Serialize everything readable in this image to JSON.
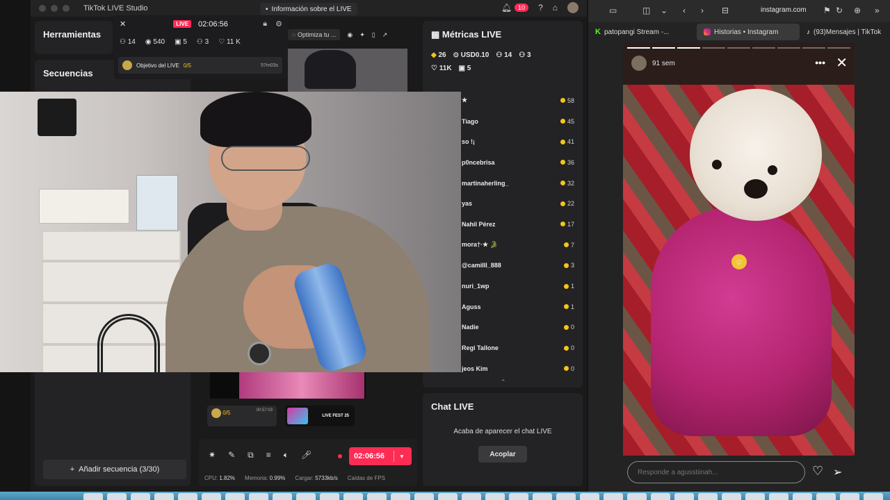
{
  "studio": {
    "title": "TikTok LIVE Studio",
    "info_button": "Información sobre el LIVE",
    "notifications_count": "10",
    "tools_heading": "Herramientas",
    "sequences_heading": "Secuencias",
    "add_sequence": "Añadir secuencia (3/30)",
    "optimize_label": "Optimiza tu ...",
    "live_overlay": {
      "live_tag": "LIVE",
      "timer": "02:06:56",
      "stats": [
        {
          "icon": "people-icon",
          "value": "14"
        },
        {
          "icon": "eye-icon",
          "value": "540"
        },
        {
          "icon": "gift-icon",
          "value": "5"
        },
        {
          "icon": "follow-icon",
          "value": "3"
        },
        {
          "icon": "heart-icon",
          "value": "11 K"
        }
      ],
      "goal_label": "Objetivo del LIVE",
      "goal_progress": "0/5",
      "goal_time": "57m03s"
    },
    "metrics": {
      "heading": "Métricas LIVE",
      "row1": [
        {
          "icon": "diamond-icon",
          "value": "26"
        },
        {
          "icon": "coin-icon",
          "value": "USD0.10"
        },
        {
          "icon": "people-icon",
          "value": "14"
        },
        {
          "icon": "follow-icon",
          "value": "3"
        }
      ],
      "row2": [
        {
          "icon": "heart-icon",
          "value": "11K"
        },
        {
          "icon": "gift-icon",
          "value": "5"
        }
      ],
      "gifters": [
        {
          "name": "★",
          "coins": "58"
        },
        {
          "name": "Tiago",
          "coins": "45"
        },
        {
          "name": "so !¡",
          "coins": "41"
        },
        {
          "name": "p0ncebrisa",
          "coins": "36"
        },
        {
          "name": "martinaherling_",
          "coins": "32"
        },
        {
          "name": "yas",
          "coins": "22"
        },
        {
          "name": "Nahil Pérez",
          "coins": "17"
        },
        {
          "name": "mora†·★ 🐊",
          "coins": "7"
        },
        {
          "name": "@camilll_888",
          "coins": "3"
        },
        {
          "name": "nuri_1wp",
          "coins": "1"
        },
        {
          "name": "Aguss",
          "coins": "1"
        },
        {
          "name": "Nadie",
          "coins": "0"
        },
        {
          "name": "Regi Tallone",
          "coins": "0"
        },
        {
          "name": "jeos Kim",
          "coins": "0"
        }
      ]
    },
    "chat": {
      "heading": "Chat LIVE",
      "message": "Acaba de aparecer el chat LIVE",
      "button": "Acoplar"
    },
    "widget_goal": {
      "progress": "0/5",
      "time": "00:57:03"
    },
    "widget_fest": "LIVE FEST 25",
    "end_button_time": "02:06:56",
    "perf": {
      "cpu_label": "CPU:",
      "cpu": "1.82%",
      "mem_label": "Memoria:",
      "mem": "0.99%",
      "load_label": "Cargar:",
      "load": "5733kb/s",
      "fps_label": "Caídas de FPS"
    }
  },
  "browser": {
    "url": "instagram.com",
    "tabs": [
      {
        "label": "patopangi Stream -...",
        "favicon": "kick-icon"
      },
      {
        "label": "Historias • Instagram",
        "favicon": "instagram-icon"
      },
      {
        "label": "(93)Mensajes | TikTok",
        "favicon": "tiktok-icon"
      }
    ],
    "story": {
      "age": "91 sem",
      "reply_placeholder": "Responde a agusstiinah..."
    }
  },
  "colors": {
    "accent": "#fe2c55",
    "coin": "#f5c518",
    "panel": "#232325"
  }
}
